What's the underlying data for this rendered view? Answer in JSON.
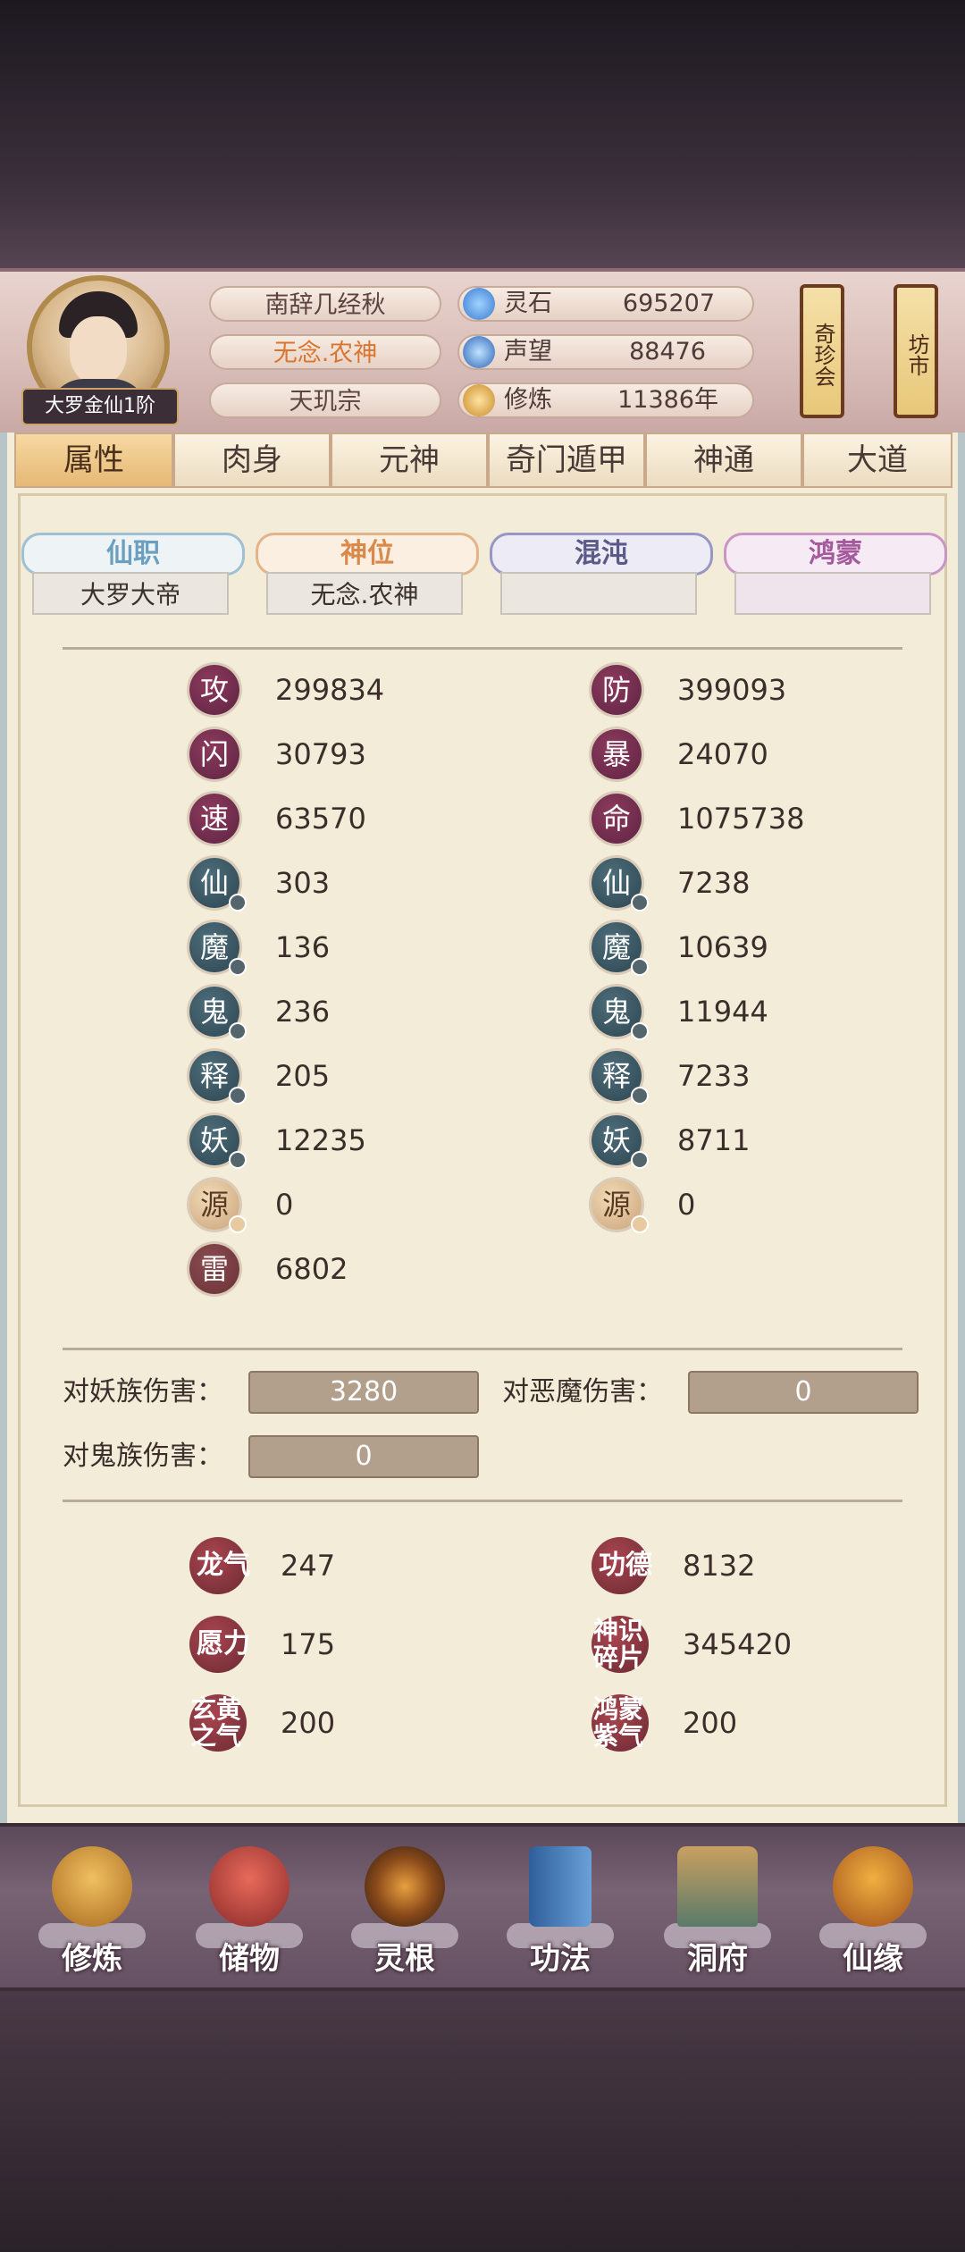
{
  "header": {
    "avatar_rank": "大罗金仙1阶",
    "player_name": "南辞几经秋",
    "title": "无念.农神",
    "sect": "天玑宗",
    "resources": [
      {
        "label": "灵石",
        "value": "695207",
        "icon": "spirit-stone-icon",
        "color": "#4a8fd8"
      },
      {
        "label": "声望",
        "value": "88476",
        "icon": "reputation-icon",
        "color": "#3a7ad0"
      },
      {
        "label": "修炼",
        "value": "11386年",
        "icon": "meditation-icon",
        "color": "#d0a040"
      }
    ],
    "scroll_buttons": [
      "奇珍会",
      "坊市"
    ]
  },
  "tabs": [
    "属性",
    "肉身",
    "元神",
    "奇门遁甲",
    "神通",
    "大道"
  ],
  "active_tab": "属性",
  "sub_tabs": [
    {
      "label": "仙职",
      "value": "大罗大帝",
      "color": "#6b9fbf"
    },
    {
      "label": "神位",
      "value": "无念.农神",
      "color": "#d98a4a"
    },
    {
      "label": "混沌",
      "value": "",
      "color": "#5b5a86"
    },
    {
      "label": "鸿蒙",
      "value": "",
      "color": "#a65a9e"
    }
  ],
  "stats_left": [
    {
      "glyph": "攻",
      "value": "299834",
      "style": "red"
    },
    {
      "glyph": "闪",
      "value": "30793",
      "style": "red"
    },
    {
      "glyph": "速",
      "value": "63570",
      "style": "red"
    },
    {
      "glyph": "仙",
      "value": "303",
      "style": "blue"
    },
    {
      "glyph": "魔",
      "value": "136",
      "style": "blue"
    },
    {
      "glyph": "鬼",
      "value": "236",
      "style": "blue"
    },
    {
      "glyph": "释",
      "value": "205",
      "style": "blue"
    },
    {
      "glyph": "妖",
      "value": "12235",
      "style": "blue"
    },
    {
      "glyph": "源",
      "value": "0",
      "style": "gold"
    },
    {
      "glyph": "雷",
      "value": "6802",
      "style": "maroon"
    }
  ],
  "stats_right": [
    {
      "glyph": "防",
      "value": "399093",
      "style": "red"
    },
    {
      "glyph": "暴",
      "value": "24070",
      "style": "red"
    },
    {
      "glyph": "命",
      "value": "1075738",
      "style": "red"
    },
    {
      "glyph": "仙",
      "value": "7238",
      "style": "blue"
    },
    {
      "glyph": "魔",
      "value": "10639",
      "style": "blue"
    },
    {
      "glyph": "鬼",
      "value": "11944",
      "style": "blue"
    },
    {
      "glyph": "释",
      "value": "7233",
      "style": "blue"
    },
    {
      "glyph": "妖",
      "value": "8711",
      "style": "blue"
    },
    {
      "glyph": "源",
      "value": "0",
      "style": "gold"
    }
  ],
  "damage": [
    {
      "label": "对妖族伤害：",
      "value": "3280"
    },
    {
      "label": "对恶魔伤害：",
      "value": "0"
    },
    {
      "label": "对鬼族伤害：",
      "value": "0"
    }
  ],
  "bonus_left": [
    {
      "glyph": "龙气",
      "value": "247"
    },
    {
      "glyph": "愿力",
      "value": "175"
    },
    {
      "glyph": "玄黄之气",
      "value": "200"
    }
  ],
  "bonus_right": [
    {
      "glyph": "功德",
      "value": "8132"
    },
    {
      "glyph": "神识碎片",
      "value": "345420"
    },
    {
      "glyph": "鸿蒙紫气",
      "value": "200"
    }
  ],
  "nav": [
    {
      "label": "修炼",
      "icon": "cultivation-icon"
    },
    {
      "label": "储物",
      "icon": "storage-bag-icon"
    },
    {
      "label": "灵根",
      "icon": "spirit-root-icon"
    },
    {
      "label": "功法",
      "icon": "technique-book-icon"
    },
    {
      "label": "洞府",
      "icon": "cave-dwelling-icon"
    },
    {
      "label": "仙缘",
      "icon": "immortal-fate-icon"
    }
  ]
}
